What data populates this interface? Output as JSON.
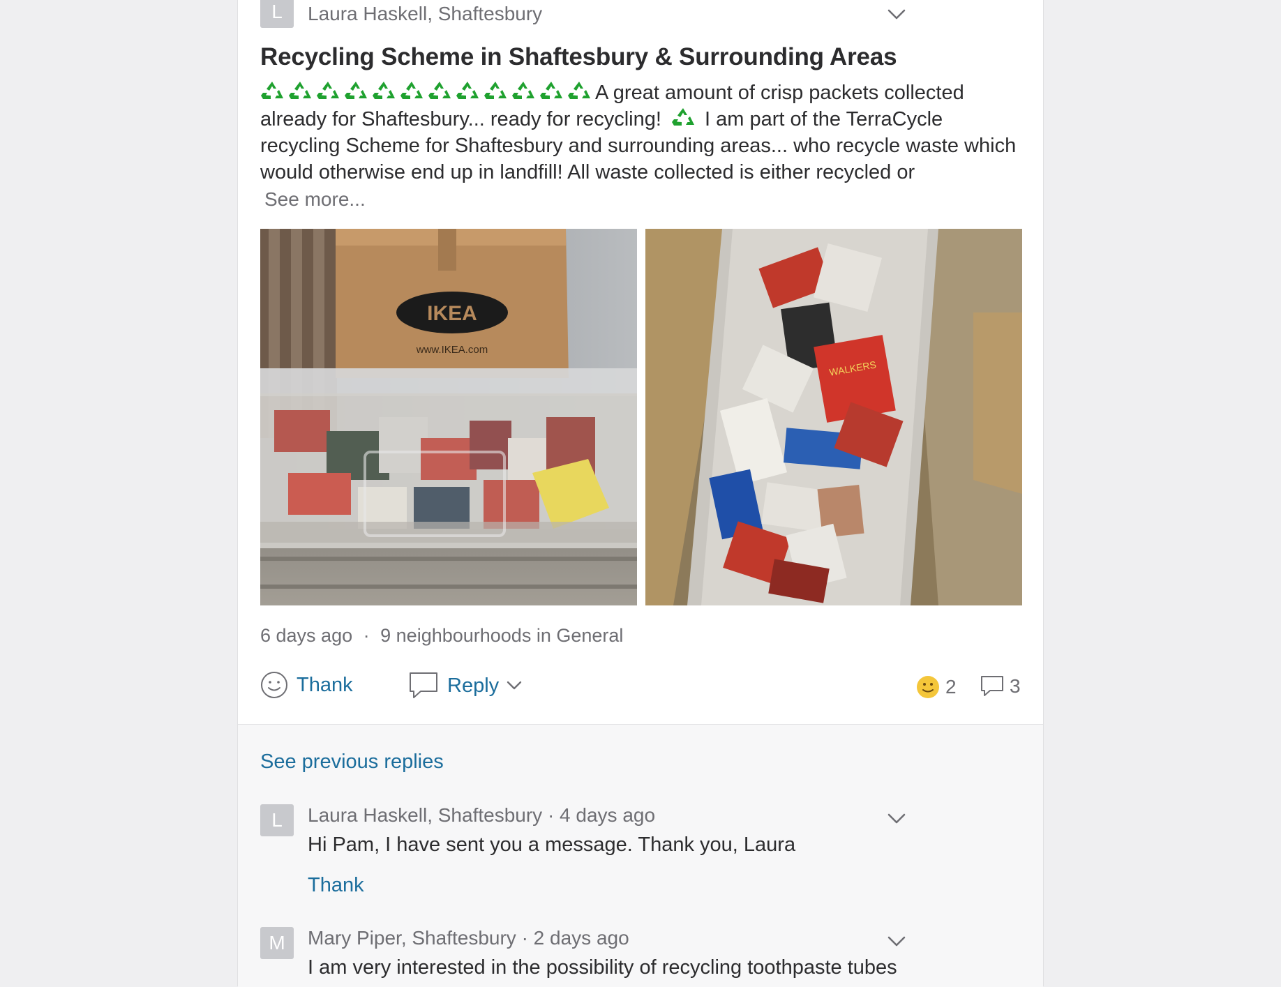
{
  "post": {
    "avatar_letter": "L",
    "author": "Laura Haskell, Shaftesbury",
    "title": "Recycling Scheme in Shaftesbury & Surrounding Areas",
    "body_after_icons": "A great amount of crisp packets collected already for Shaftesbury... ready for recycling!",
    "body_rest": "I am part of the TerraCycle recycling Scheme for Shaftesbury and surrounding areas... who recycle waste which would otherwise end up in landfill! All waste collected is either recycled or",
    "see_more": "See more...",
    "recycle_icon_count": 12,
    "photos": [
      {
        "name": "ikea-box-photo",
        "box_label": "IKEA",
        "box_url": "www.IKEA.com"
      },
      {
        "name": "crisp-packets-photo",
        "packet_label": "WALKERS"
      }
    ],
    "age": "6 days ago",
    "separator": "·",
    "audience": "9 neighbourhoods in General",
    "actions": {
      "thank": "Thank",
      "reply": "Reply"
    },
    "counts": {
      "thanks": "2",
      "replies": "3"
    }
  },
  "replies_section": {
    "see_previous": "See previous replies",
    "items": [
      {
        "avatar_letter": "L",
        "author": "Laura Haskell, Shaftesbury · 4 days ago",
        "text": "Hi Pam, I have sent you a message. Thank you, Laura",
        "thank": "Thank"
      },
      {
        "avatar_letter": "M",
        "author": "Mary Piper, Shaftesbury · 2 days ago",
        "text": "I am very interested in the possibility of recycling toothpaste tubes"
      }
    ]
  },
  "colors": {
    "link": "#1b6d9c",
    "muted": "#6e6e73",
    "recycle_green": "#1fa12f",
    "emoji_yellow": "#f4c63a"
  }
}
